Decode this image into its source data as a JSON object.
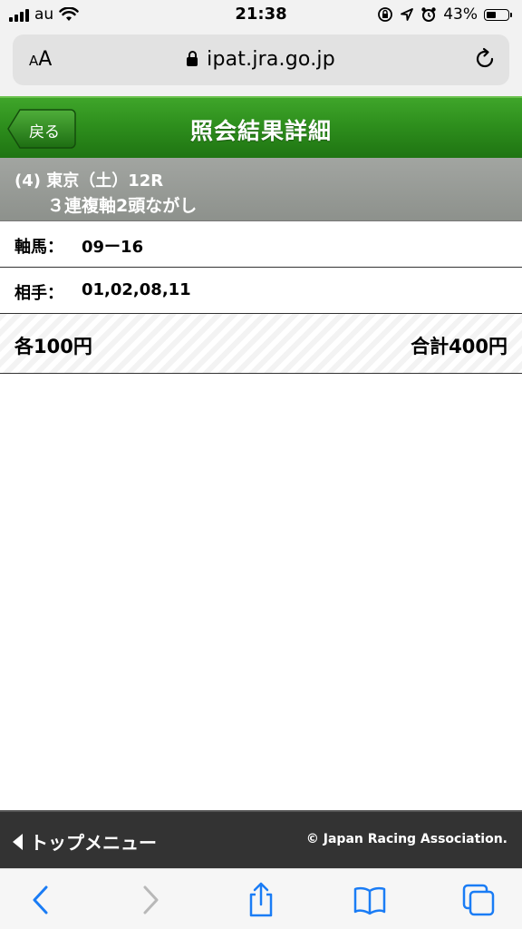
{
  "status_bar": {
    "carrier": "au",
    "time": "21:38",
    "battery": "43%"
  },
  "browser": {
    "aa_small": "A",
    "aa_large": "A",
    "url": "ipat.jra.go.jp"
  },
  "header": {
    "back_label": "戻る",
    "title": "照会結果詳細"
  },
  "race": {
    "line1": "(4) 東京（土）12R",
    "line2": "３連複軸2頭ながし"
  },
  "rows": [
    {
      "label": "軸馬：",
      "value": "09ー16"
    },
    {
      "label": "相手：",
      "value": "01,02,08,11"
    }
  ],
  "totals": {
    "each": "各100円",
    "total": "合計400円"
  },
  "footer": {
    "menu_label": "トップメニュー",
    "copyright": "© Japan Racing Association."
  },
  "colors": {
    "header_green": "#2e8f1d",
    "race_gray": "#969a95",
    "footer_dark": "#333333",
    "ios_blue": "#1a7cf5"
  },
  "toolbar_icons": [
    "back-icon",
    "forward-icon",
    "share-icon",
    "bookmarks-icon",
    "tabs-icon"
  ]
}
